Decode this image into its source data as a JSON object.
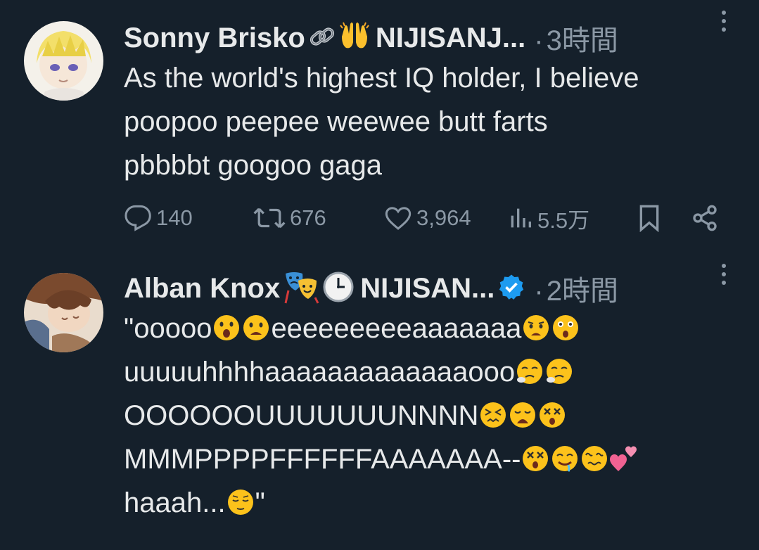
{
  "tweets": [
    {
      "author": "Sonny Brisko",
      "author_suffix": "NIJISANJ...",
      "badge_emojis": [
        "link-emoji",
        "raising-hands-emoji"
      ],
      "time": "3時間",
      "text": "As the world's highest IQ holder, I believe\npoopoo peepee weewee butt farts\npbbbbt googoo gaga",
      "metrics": {
        "replies": "140",
        "retweets": "676",
        "likes": "3,964",
        "views": "5.5万"
      }
    },
    {
      "author": "Alban Knox",
      "author_suffix": "NIJISAN...",
      "badge_emojis": [
        "performing-arts-emoji",
        "clock-emoji"
      ],
      "verified": true,
      "time": "2時間",
      "text_lines": [
        {
          "text": "\"ooooo",
          "emojis_after": [
            "surprised-face",
            "frowning-open-face"
          ],
          "tail": "eeeeeeeeeaaaaaaa",
          "tail_emojis": [
            "anguished-face",
            "astonished-face"
          ]
        },
        {
          "text": "uuuuuhhhhaaaaaaaaaaaaaooo",
          "emojis_after": [
            "steam-face",
            "steam-face"
          ]
        },
        {
          "text": "OOOOOOUUUUUUUNNNN",
          "emojis_after": [
            "confounded-face",
            "weary-face",
            "dizzy-face"
          ]
        },
        {
          "text": "MMMPPPPFFFFFFAAAAAAA--",
          "emojis_after": [
            "dizzy-face",
            "drooling-face",
            "woozy-face",
            "two-hearts"
          ]
        },
        {
          "text": "haaah...",
          "emojis_after": [
            "relieved-face"
          ],
          "tail": "\""
        }
      ]
    }
  ],
  "colors": {
    "background": "#15202b",
    "text": "#e7e9ea",
    "muted": "#8b98a5",
    "verified": "#1d9bf0"
  }
}
